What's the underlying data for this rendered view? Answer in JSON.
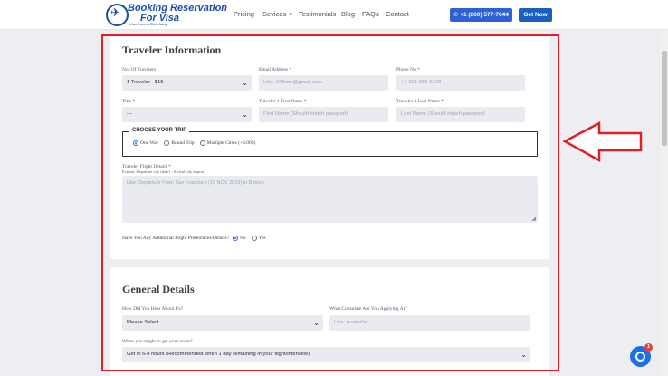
{
  "header": {
    "logo_title_line1": "Booking Reservation",
    "logo_title_line2": "For Visa",
    "logo_tagline": "Visa Docs A Click Away",
    "nav": [
      "Pricing",
      "Sevices",
      "Testimonials",
      "Blog",
      "FAQs",
      "Contact"
    ],
    "phone_button": "+1 (260) 577-7644",
    "cta_button": "Get Now",
    "colors": {
      "primary": "#2e62d4",
      "brand": "#1c4fa8"
    }
  },
  "traveler": {
    "title": "Traveler Information",
    "num_travelers_label": "No. Of Travelers",
    "num_travelers_value": "1 Traveler - $15",
    "email_label": "Email Address *",
    "email_placeholder": "Like: William@gmail.com",
    "phone_label": "Phone No *",
    "phone_placeholder": "+1 201-555-0123",
    "title_label": "Title *",
    "title_value": "---",
    "first_name_label": "Traveler 1 First Name *",
    "first_name_placeholder": "First Name (Should match passport)",
    "last_name_label": "Traveler 1 Last Name *",
    "last_name_placeholder": "Last Name (Should match passport)",
    "trip_legend": "CHOOSE YOUR TRIP",
    "trip_options": [
      "One Way",
      "Round Trip",
      "Multiple Cities (+3.00$)"
    ],
    "trip_selected": "One Way",
    "flight_details_label": "Traveler Flight Details *",
    "flight_details_hint": "Format: Departure city (date) - Arrival city airport",
    "flight_details_placeholder": "Like: Departure From San Francisco (15 NOV 2019) to Boston",
    "prefs_label": "Have You Any Additional Flight Preferences/Details?",
    "prefs_options": [
      "No",
      "Yes"
    ],
    "prefs_selected": "No"
  },
  "general": {
    "title": "General Details",
    "heard_label": "How Did You Hear About Us?",
    "heard_value": "Please Select",
    "consulate_label": "What Consulate Are You Applying At?",
    "consulate_placeholder": "Like: Australia",
    "when_label": "When you might to get your order?",
    "when_value": "Get in 6-8 hours (Recommended when 1 day remaining in your flight/interview)"
  },
  "chat": {
    "badge": "1"
  },
  "highlight_color": "#e01f26"
}
